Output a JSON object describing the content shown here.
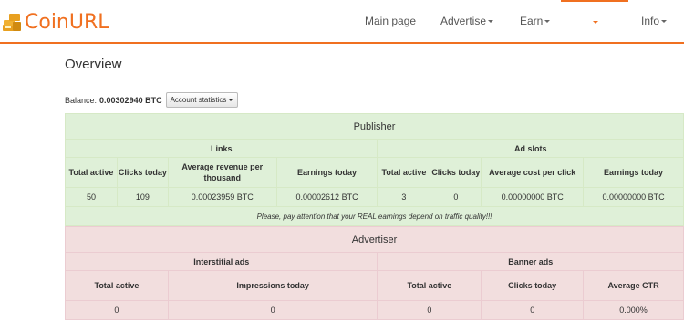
{
  "brand": {
    "name": "CoinURL"
  },
  "nav": {
    "items": [
      "Main page",
      "Advertise",
      "Earn",
      "",
      "Info"
    ]
  },
  "overview": {
    "title": "Overview"
  },
  "balance": {
    "label": "Balance:",
    "value": "0.00302940 BTC",
    "stats_button": "Account statistics"
  },
  "publisher": {
    "title": "Publisher",
    "links": {
      "title": "Links",
      "headers": [
        "Total active",
        "Clicks today",
        "Average revenue per thousand",
        "Earnings today"
      ],
      "values": [
        "50",
        "109",
        "0.00023959 BTC",
        "0.00002612 BTC"
      ]
    },
    "ad_slots": {
      "title": "Ad slots",
      "headers": [
        "Total active",
        "Clicks today",
        "Average cost per click",
        "Earnings today"
      ],
      "values": [
        "3",
        "0",
        "0.00000000 BTC",
        "0.00000000 BTC"
      ]
    },
    "note": "Please, pay attention that your REAL earnings depend on traffic quality!!!"
  },
  "advertiser": {
    "title": "Advertiser",
    "interstitial": {
      "title": "Interstitial ads",
      "headers": [
        "Total active",
        "Impressions today"
      ],
      "values": [
        "0",
        "0"
      ]
    },
    "banner": {
      "title": "Banner ads",
      "headers": [
        "Total active",
        "Clicks today",
        "Average CTR"
      ],
      "values": [
        "0",
        "0",
        "0.000%"
      ]
    }
  },
  "colors": {
    "accent": "#f07020",
    "publisher_bg": "#dff0d8",
    "advertiser_bg": "#f2dede"
  }
}
